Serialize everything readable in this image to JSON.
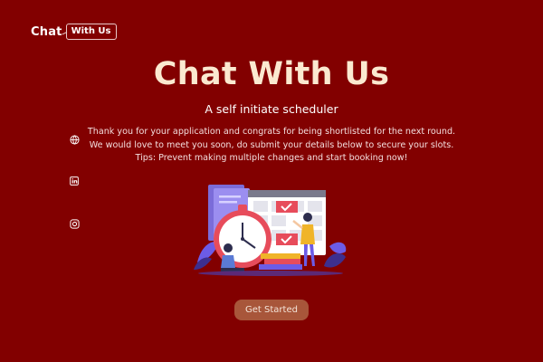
{
  "header": {
    "logo_text": "Chat",
    "logo_box_text": "With Us"
  },
  "social": [
    {
      "icon": "globe-icon"
    },
    {
      "icon": "linkedin-icon"
    },
    {
      "icon": "instagram-icon"
    }
  ],
  "hero": {
    "title": "Chat With Us",
    "subtitle": "A self initiate scheduler",
    "description_lines": [
      "Thank you for your application and congrats for being shortlisted for the next round.",
      "We would love to meet you soon, do submit your details below to secure your slots.",
      "Tips: Prevent making multiple changes and start booking now!"
    ]
  },
  "cta": {
    "label": "Get Started"
  },
  "colors": {
    "background": "#820000",
    "title": "#fbe9d0",
    "button": "#a8563a"
  }
}
